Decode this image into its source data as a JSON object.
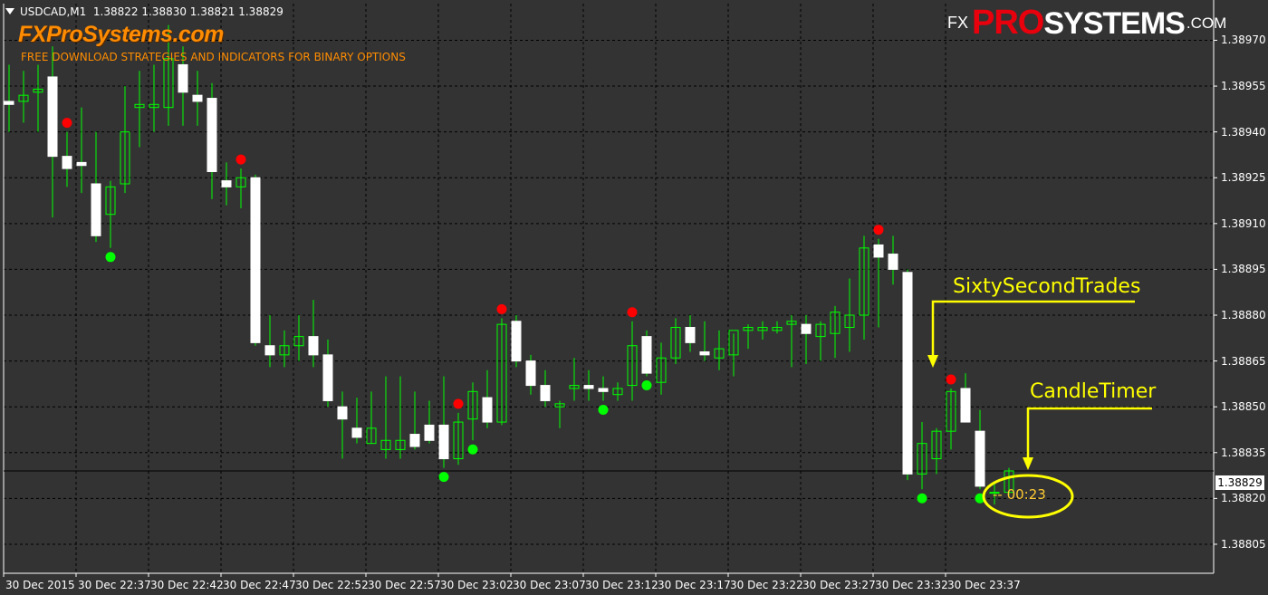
{
  "header": {
    "symbol": "USDCAD,M1",
    "ohlc": "1.38822 1.38830 1.38821 1.38829"
  },
  "brand": {
    "title": "FXProSystems.com",
    "subtitle": "FREE DOWNLOAD STRATEGIES AND INDICATORS FOR BINARY OPTIONS"
  },
  "logo": {
    "fx": "FX",
    "pro": "PRO",
    "systems": "SYSTEMS",
    "com": ".COM"
  },
  "current_price": "1.38829",
  "callouts": {
    "sixty": "SixtySecondTrades",
    "timer_label": "CandleTimer",
    "timer_value": "-- 00:23"
  },
  "colors": {
    "background": "#333333",
    "grid": "#000000",
    "bull_candle_outline": "#00ff00",
    "bear_candle_fill": "#ffffff",
    "sell_signal": "#ff0000",
    "buy_signal": "#00ff00",
    "brand_orange": "#ff8c00",
    "callout": "#ffff00"
  },
  "chart_data": {
    "type": "candlestick",
    "symbol": "USDCAD",
    "timeframe": "M1",
    "ylim": [
      1.388,
      1.3898
    ],
    "y_ticks": [
      "1.38970",
      "1.38955",
      "1.38940",
      "1.38925",
      "1.38910",
      "1.38895",
      "1.38880",
      "1.38865",
      "1.38850",
      "1.38835",
      "1.38820",
      "1.38805"
    ],
    "x_ticks": [
      "30 Dec 2015",
      "30 Dec 22:37",
      "30 Dec 22:42",
      "30 Dec 22:47",
      "30 Dec 22:52",
      "30 Dec 22:57",
      "30 Dec 23:02",
      "30 Dec 23:07",
      "30 Dec 23:12",
      "30 Dec 23:17",
      "30 Dec 23:22",
      "30 Dec 23:27",
      "30 Dec 23:32",
      "30 Dec 23:37"
    ],
    "candles": [
      {
        "o": 1.3895,
        "h": 1.38962,
        "l": 1.3894,
        "c": 1.38949
      },
      {
        "o": 1.3895,
        "h": 1.3896,
        "l": 1.38943,
        "c": 1.38952
      },
      {
        "o": 1.38953,
        "h": 1.38962,
        "l": 1.3894,
        "c": 1.38954
      },
      {
        "o": 1.38958,
        "h": 1.38968,
        "l": 1.38912,
        "c": 1.38932
      },
      {
        "o": 1.38932,
        "h": 1.3894,
        "l": 1.38922,
        "c": 1.38928
      },
      {
        "o": 1.3893,
        "h": 1.38948,
        "l": 1.3892,
        "c": 1.38929
      },
      {
        "o": 1.38923,
        "h": 1.3894,
        "l": 1.38904,
        "c": 1.38906
      },
      {
        "o": 1.38913,
        "h": 1.38924,
        "l": 1.38902,
        "c": 1.38922
      },
      {
        "o": 1.38923,
        "h": 1.38955,
        "l": 1.3892,
        "c": 1.3894
      },
      {
        "o": 1.38948,
        "h": 1.3896,
        "l": 1.38935,
        "c": 1.38949
      },
      {
        "o": 1.38948,
        "h": 1.38962,
        "l": 1.3894,
        "c": 1.38949
      },
      {
        "o": 1.38948,
        "h": 1.38975,
        "l": 1.38942,
        "c": 1.38964
      },
      {
        "o": 1.38962,
        "h": 1.38968,
        "l": 1.38942,
        "c": 1.38953
      },
      {
        "o": 1.38952,
        "h": 1.3896,
        "l": 1.38942,
        "c": 1.3895
      },
      {
        "o": 1.38951,
        "h": 1.38956,
        "l": 1.38918,
        "c": 1.38927
      },
      {
        "o": 1.38924,
        "h": 1.3893,
        "l": 1.38916,
        "c": 1.38922
      },
      {
        "o": 1.38922,
        "h": 1.38928,
        "l": 1.38915,
        "c": 1.38925
      },
      {
        "o": 1.38925,
        "h": 1.38926,
        "l": 1.3887,
        "c": 1.38871
      },
      {
        "o": 1.3887,
        "h": 1.3888,
        "l": 1.38863,
        "c": 1.38867
      },
      {
        "o": 1.38867,
        "h": 1.38875,
        "l": 1.38863,
        "c": 1.3887
      },
      {
        "o": 1.3887,
        "h": 1.3888,
        "l": 1.38865,
        "c": 1.38873
      },
      {
        "o": 1.38873,
        "h": 1.38885,
        "l": 1.38863,
        "c": 1.38867
      },
      {
        "o": 1.38867,
        "h": 1.38872,
        "l": 1.3885,
        "c": 1.38852
      },
      {
        "o": 1.3885,
        "h": 1.38855,
        "l": 1.38833,
        "c": 1.38846
      },
      {
        "o": 1.38843,
        "h": 1.38853,
        "l": 1.38838,
        "c": 1.3884
      },
      {
        "o": 1.38838,
        "h": 1.38855,
        "l": 1.38838,
        "c": 1.38843
      },
      {
        "o": 1.38836,
        "h": 1.3886,
        "l": 1.38833,
        "c": 1.38839
      },
      {
        "o": 1.38836,
        "h": 1.3886,
        "l": 1.38833,
        "c": 1.38839
      },
      {
        "o": 1.38841,
        "h": 1.38855,
        "l": 1.38836,
        "c": 1.38837
      },
      {
        "o": 1.38844,
        "h": 1.38852,
        "l": 1.38838,
        "c": 1.38839
      },
      {
        "o": 1.38844,
        "h": 1.3886,
        "l": 1.3883,
        "c": 1.38833
      },
      {
        "o": 1.38833,
        "h": 1.38848,
        "l": 1.38831,
        "c": 1.38845
      },
      {
        "o": 1.38846,
        "h": 1.38858,
        "l": 1.38839,
        "c": 1.38855
      },
      {
        "o": 1.38853,
        "h": 1.38862,
        "l": 1.38843,
        "c": 1.38845
      },
      {
        "o": 1.38845,
        "h": 1.38879,
        "l": 1.38844,
        "c": 1.38877
      },
      {
        "o": 1.38878,
        "h": 1.3888,
        "l": 1.38863,
        "c": 1.38865
      },
      {
        "o": 1.38865,
        "h": 1.38867,
        "l": 1.38854,
        "c": 1.38857
      },
      {
        "o": 1.38857,
        "h": 1.38862,
        "l": 1.3885,
        "c": 1.38852
      },
      {
        "o": 1.3885,
        "h": 1.38852,
        "l": 1.38843,
        "c": 1.38851
      },
      {
        "o": 1.38856,
        "h": 1.38866,
        "l": 1.38852,
        "c": 1.38857
      },
      {
        "o": 1.38857,
        "h": 1.38862,
        "l": 1.38852,
        "c": 1.38856
      },
      {
        "o": 1.38856,
        "h": 1.3886,
        "l": 1.38852,
        "c": 1.38855
      },
      {
        "o": 1.38854,
        "h": 1.38858,
        "l": 1.38852,
        "c": 1.38856
      },
      {
        "o": 1.38857,
        "h": 1.38878,
        "l": 1.38852,
        "c": 1.3887
      },
      {
        "o": 1.38873,
        "h": 1.38875,
        "l": 1.3886,
        "c": 1.38861
      },
      {
        "o": 1.38858,
        "h": 1.38871,
        "l": 1.38854,
        "c": 1.38866
      },
      {
        "o": 1.38866,
        "h": 1.38879,
        "l": 1.38864,
        "c": 1.38876
      },
      {
        "o": 1.38876,
        "h": 1.3888,
        "l": 1.38868,
        "c": 1.38871
      },
      {
        "o": 1.38868,
        "h": 1.38878,
        "l": 1.38865,
        "c": 1.38867
      },
      {
        "o": 1.38866,
        "h": 1.38875,
        "l": 1.38862,
        "c": 1.38869
      },
      {
        "o": 1.38867,
        "h": 1.38874,
        "l": 1.3886,
        "c": 1.38875
      },
      {
        "o": 1.38875,
        "h": 1.38877,
        "l": 1.38869,
        "c": 1.38876
      },
      {
        "o": 1.38875,
        "h": 1.38878,
        "l": 1.38872,
        "c": 1.38876
      },
      {
        "o": 1.38875,
        "h": 1.38878,
        "l": 1.38874,
        "c": 1.38876
      },
      {
        "o": 1.38877,
        "h": 1.3888,
        "l": 1.38863,
        "c": 1.38878
      },
      {
        "o": 1.38877,
        "h": 1.3888,
        "l": 1.38864,
        "c": 1.38874
      },
      {
        "o": 1.38873,
        "h": 1.38878,
        "l": 1.38865,
        "c": 1.38877
      },
      {
        "o": 1.38874,
        "h": 1.38883,
        "l": 1.38866,
        "c": 1.38881
      },
      {
        "o": 1.38876,
        "h": 1.38892,
        "l": 1.38868,
        "c": 1.3888
      },
      {
        "o": 1.3888,
        "h": 1.38906,
        "l": 1.38872,
        "c": 1.38902
      },
      {
        "o": 1.38903,
        "h": 1.38905,
        "l": 1.38876,
        "c": 1.38899
      },
      {
        "o": 1.389,
        "h": 1.38906,
        "l": 1.3889,
        "c": 1.38895
      },
      {
        "o": 1.38894,
        "h": 1.38895,
        "l": 1.38826,
        "c": 1.38828
      },
      {
        "o": 1.38828,
        "h": 1.38845,
        "l": 1.38823,
        "c": 1.38838
      },
      {
        "o": 1.38833,
        "h": 1.38843,
        "l": 1.38828,
        "c": 1.38842
      },
      {
        "o": 1.38842,
        "h": 1.38856,
        "l": 1.38836,
        "c": 1.38855
      },
      {
        "o": 1.38856,
        "h": 1.38861,
        "l": 1.38845,
        "c": 1.38845
      },
      {
        "o": 1.38842,
        "h": 1.38849,
        "l": 1.38823,
        "c": 1.38824
      },
      {
        "o": 1.38822,
        "h": 1.38825,
        "l": 1.38818,
        "c": 1.38822
      },
      {
        "o": 1.38822,
        "h": 1.3883,
        "l": 1.38821,
        "c": 1.38829
      }
    ],
    "sell_signals": [
      4,
      16,
      31,
      34,
      43,
      60,
      65
    ],
    "buy_signals": [
      7,
      30,
      32,
      41,
      44,
      63,
      67
    ]
  }
}
